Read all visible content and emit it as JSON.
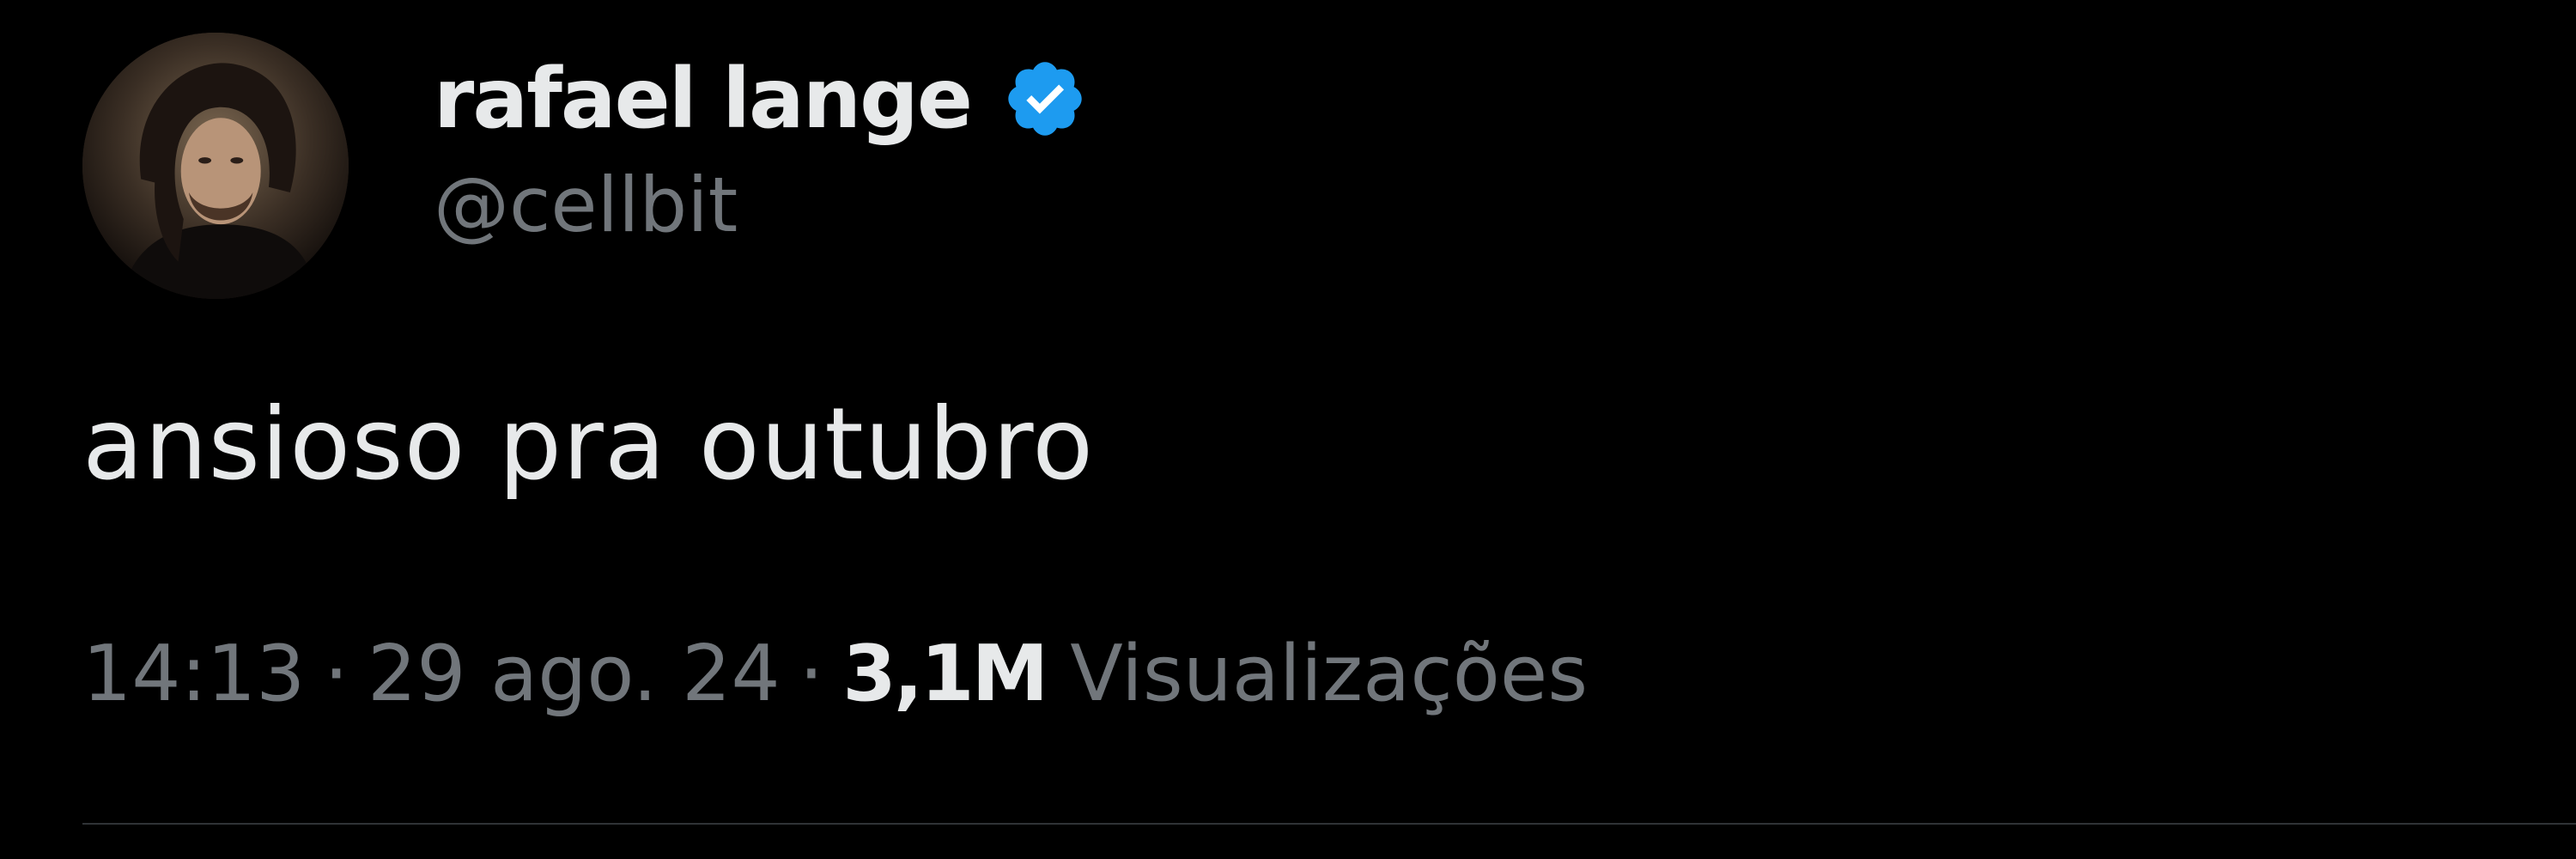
{
  "tweet": {
    "author": {
      "display_name": "rafael lange",
      "handle": "@cellbit",
      "verified": true,
      "verified_icon": "verified-badge-icon",
      "verified_color": "#1d9bf0"
    },
    "text": "ansioso pra outubro",
    "time": "14:13",
    "date": "29 ago. 24",
    "separator": "·",
    "views_count": "3,1M",
    "views_label": "Visualizações"
  },
  "colors": {
    "background": "#000000",
    "primary_text": "#e7e9ea",
    "secondary_text": "#71767b",
    "divider": "#2f3336"
  }
}
